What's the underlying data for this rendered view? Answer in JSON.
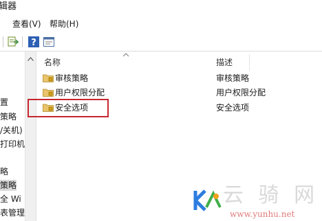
{
  "window": {
    "title": "辑器"
  },
  "menu": {
    "items": [
      {
        "id": "view",
        "label": "查看(V)"
      },
      {
        "id": "help",
        "label": "帮助(H)"
      }
    ]
  },
  "left_tree": {
    "items": [
      {
        "label": "置"
      },
      {
        "label": "策略"
      },
      {
        "label": "/关机)"
      },
      {
        "label": "打印机"
      },
      {
        "label": "略"
      },
      {
        "label": "策略"
      },
      {
        "label": "全 Wi"
      },
      {
        "label": "表管理"
      }
    ]
  },
  "columns": {
    "name": "名称",
    "description": "描述"
  },
  "rows": [
    {
      "name": "审核策略",
      "description": "审核策略"
    },
    {
      "name": "用户权限分配",
      "description": "用户权限分配"
    },
    {
      "name": "安全选项",
      "description": "安全选项"
    }
  ],
  "watermark": {
    "text": "云 骑 网",
    "url": "www.yunhu.net"
  },
  "colors": {
    "highlight": "#c6262e",
    "folder": "#e9c46a",
    "accent": "#2d7de0"
  }
}
